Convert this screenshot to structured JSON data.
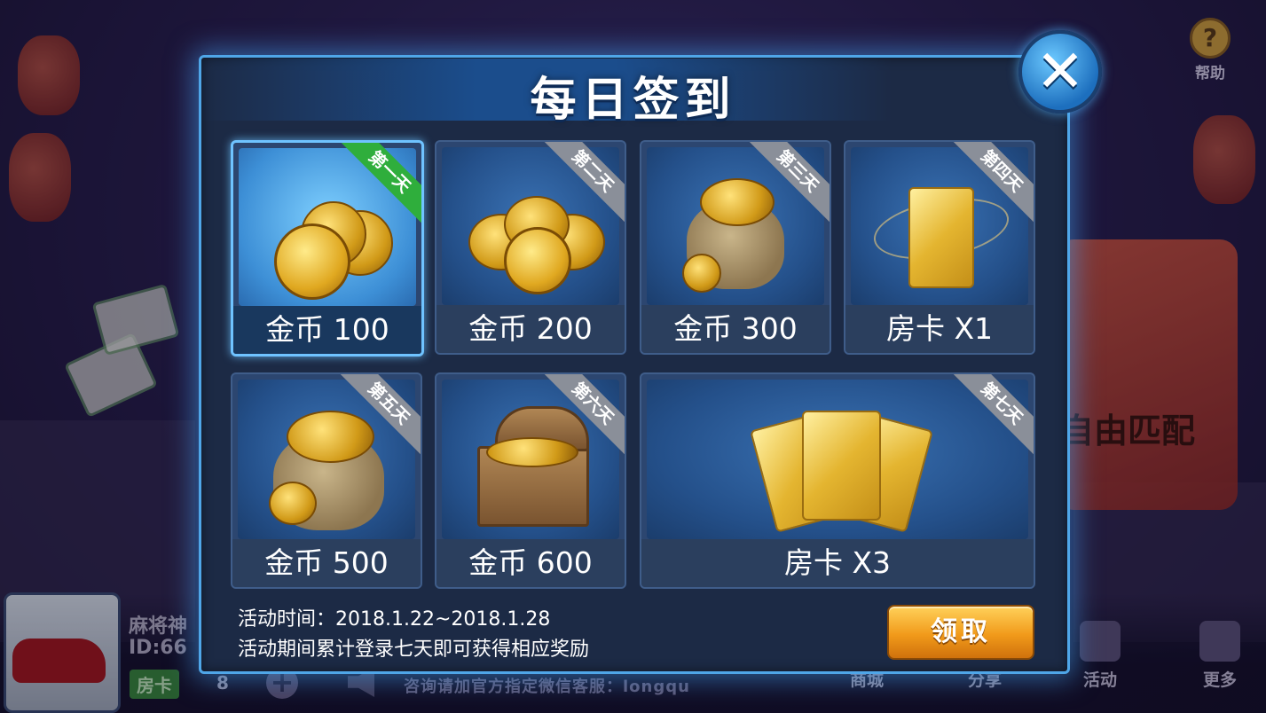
{
  "background": {
    "help_label": "帮助",
    "free_match_label": "自由匹配",
    "player": {
      "name": "麻将神",
      "id": "ID:66",
      "room_card_label": "房卡",
      "room_card_count": "8"
    },
    "marquee": "咨询请加官方指定微信客服：longqu",
    "nav": [
      "商城",
      "分享",
      "活动",
      "更多"
    ]
  },
  "dialog": {
    "title": "每日签到",
    "days": [
      {
        "ribbon": "第一天",
        "reward": "金币 100",
        "icon": "coin-stack-icon",
        "active": true
      },
      {
        "ribbon": "第二天",
        "reward": "金币 200",
        "icon": "coin-pile-icon",
        "active": false
      },
      {
        "ribbon": "第三天",
        "reward": "金币 300",
        "icon": "coin-bag-icon",
        "active": false
      },
      {
        "ribbon": "第四天",
        "reward": "房卡 X1",
        "icon": "room-card-icon",
        "active": false
      },
      {
        "ribbon": "第五天",
        "reward": "金币 500",
        "icon": "coin-sack-icon",
        "active": false
      },
      {
        "ribbon": "第六天",
        "reward": "金币 600",
        "icon": "treasure-chest-icon",
        "active": false
      },
      {
        "ribbon": "第七天",
        "reward": "房卡 X3",
        "icon": "room-cards-icon",
        "active": false
      }
    ],
    "event_time": "活动时间：2018.1.22~2018.1.28",
    "event_desc": "活动期间累计登录七天即可获得相应奖励",
    "claim_label": "领取"
  },
  "colors": {
    "dialog_border": "#4fa6e8",
    "active_ribbon": "#2fae3c",
    "inactive_ribbon": "#8a8f99",
    "claim_button": "#f19a1a"
  }
}
